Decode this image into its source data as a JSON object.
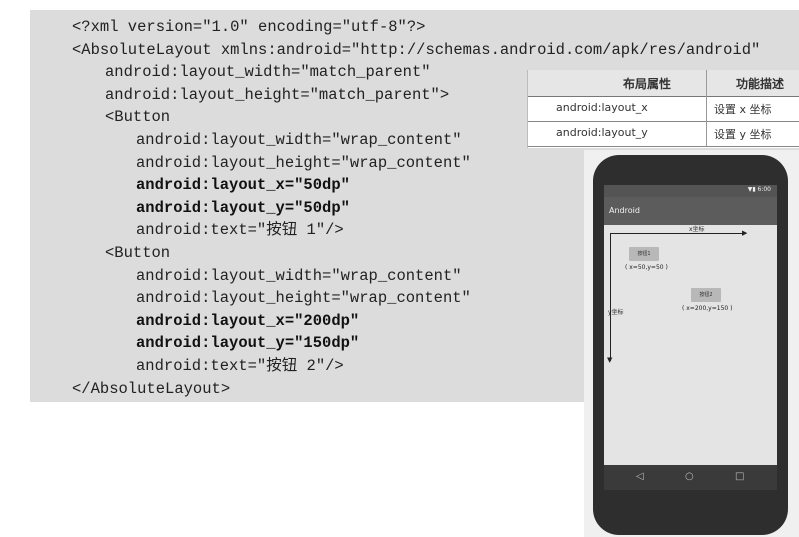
{
  "code": {
    "lines": [
      {
        "text": "<?xml version=\"1.0\" encoding=\"utf-8\"?>",
        "bold": false
      },
      {
        "text": "<AbsoluteLayout xmlns:android=\"http://schemas.android.com/apk/res/android\"",
        "bold": false
      },
      {
        "text": "android:layout_width=\"match_parent\"",
        "bold": false
      },
      {
        "text": "android:layout_height=\"match_parent\">",
        "bold": false
      },
      {
        "text": "<Button",
        "bold": false
      },
      {
        "text": "android:layout_width=\"wrap_content\"",
        "bold": false
      },
      {
        "text": "android:layout_height=\"wrap_content\"",
        "bold": false
      },
      {
        "text": "android:layout_x=\"50dp\"",
        "bold": true
      },
      {
        "text": "android:layout_y=\"50dp\"",
        "bold": true
      },
      {
        "text": "android:text=\"按钮 1\"/>",
        "bold": false
      },
      {
        "text": "<Button",
        "bold": false
      },
      {
        "text": "android:layout_width=\"wrap_content\"",
        "bold": false
      },
      {
        "text": "android:layout_height=\"wrap_content\"",
        "bold": false
      },
      {
        "text": "android:layout_x=\"200dp\"",
        "bold": true
      },
      {
        "text": "android:layout_y=\"150dp\"",
        "bold": true
      },
      {
        "text": "android:text=\"按钮 2\"/>",
        "bold": false
      },
      {
        "text": "</AbsoluteLayout>",
        "bold": false
      }
    ]
  },
  "table": {
    "headers": [
      "布局属性",
      "功能描述"
    ],
    "rows": [
      [
        "android:layout_x",
        "设置 x 坐标"
      ],
      [
        "android:layout_y",
        "设置 y 坐标"
      ]
    ]
  },
  "phone": {
    "status_time": "▼▮ 6:00",
    "app_title": "Android",
    "x_axis_label": "x坐标",
    "y_axis_label": "y坐标",
    "button1_label": "按钮1",
    "button1_coord": "( x=50,y=50 )",
    "button2_label": "按钮2",
    "button2_coord": "( x=200,y=150 )",
    "nav_back": "◁",
    "nav_home": "○",
    "nav_recent": "□"
  }
}
